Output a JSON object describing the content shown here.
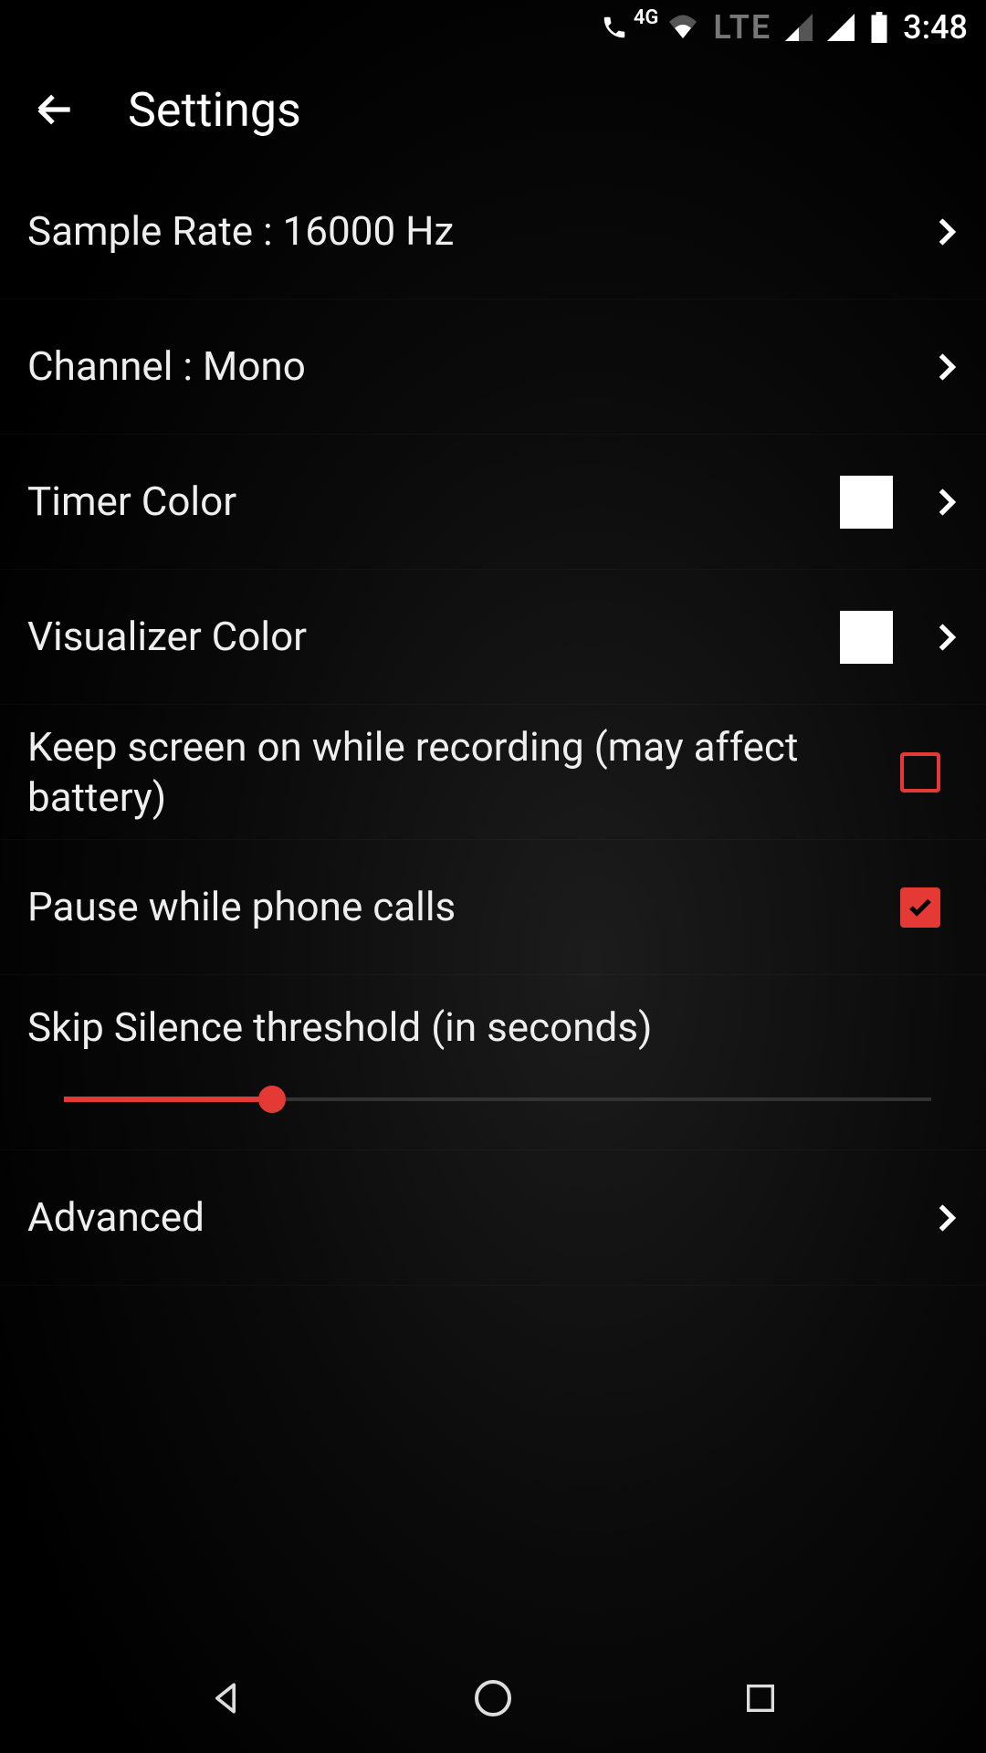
{
  "status": {
    "network_label_4g": "4G",
    "network_label_lte": "LTE",
    "time": "3:48"
  },
  "header": {
    "title": "Settings"
  },
  "settings": {
    "sample_rate": {
      "label": "Sample Rate : 16000 Hz"
    },
    "channel": {
      "label": "Channel : Mono"
    },
    "timer_color": {
      "label": "Timer Color",
      "swatch": "#ffffff"
    },
    "visualizer_color": {
      "label": "Visualizer Color",
      "swatch": "#ffffff"
    },
    "keep_screen_on": {
      "label": "Keep screen on while recording (may affect battery)",
      "checked": false
    },
    "pause_calls": {
      "label": "Pause while phone calls",
      "checked": true
    },
    "skip_silence": {
      "label": "Skip Silence threshold (in seconds)",
      "value_pct": 24
    },
    "advanced": {
      "label": "Advanced"
    }
  },
  "colors": {
    "accent": "#e53935"
  }
}
